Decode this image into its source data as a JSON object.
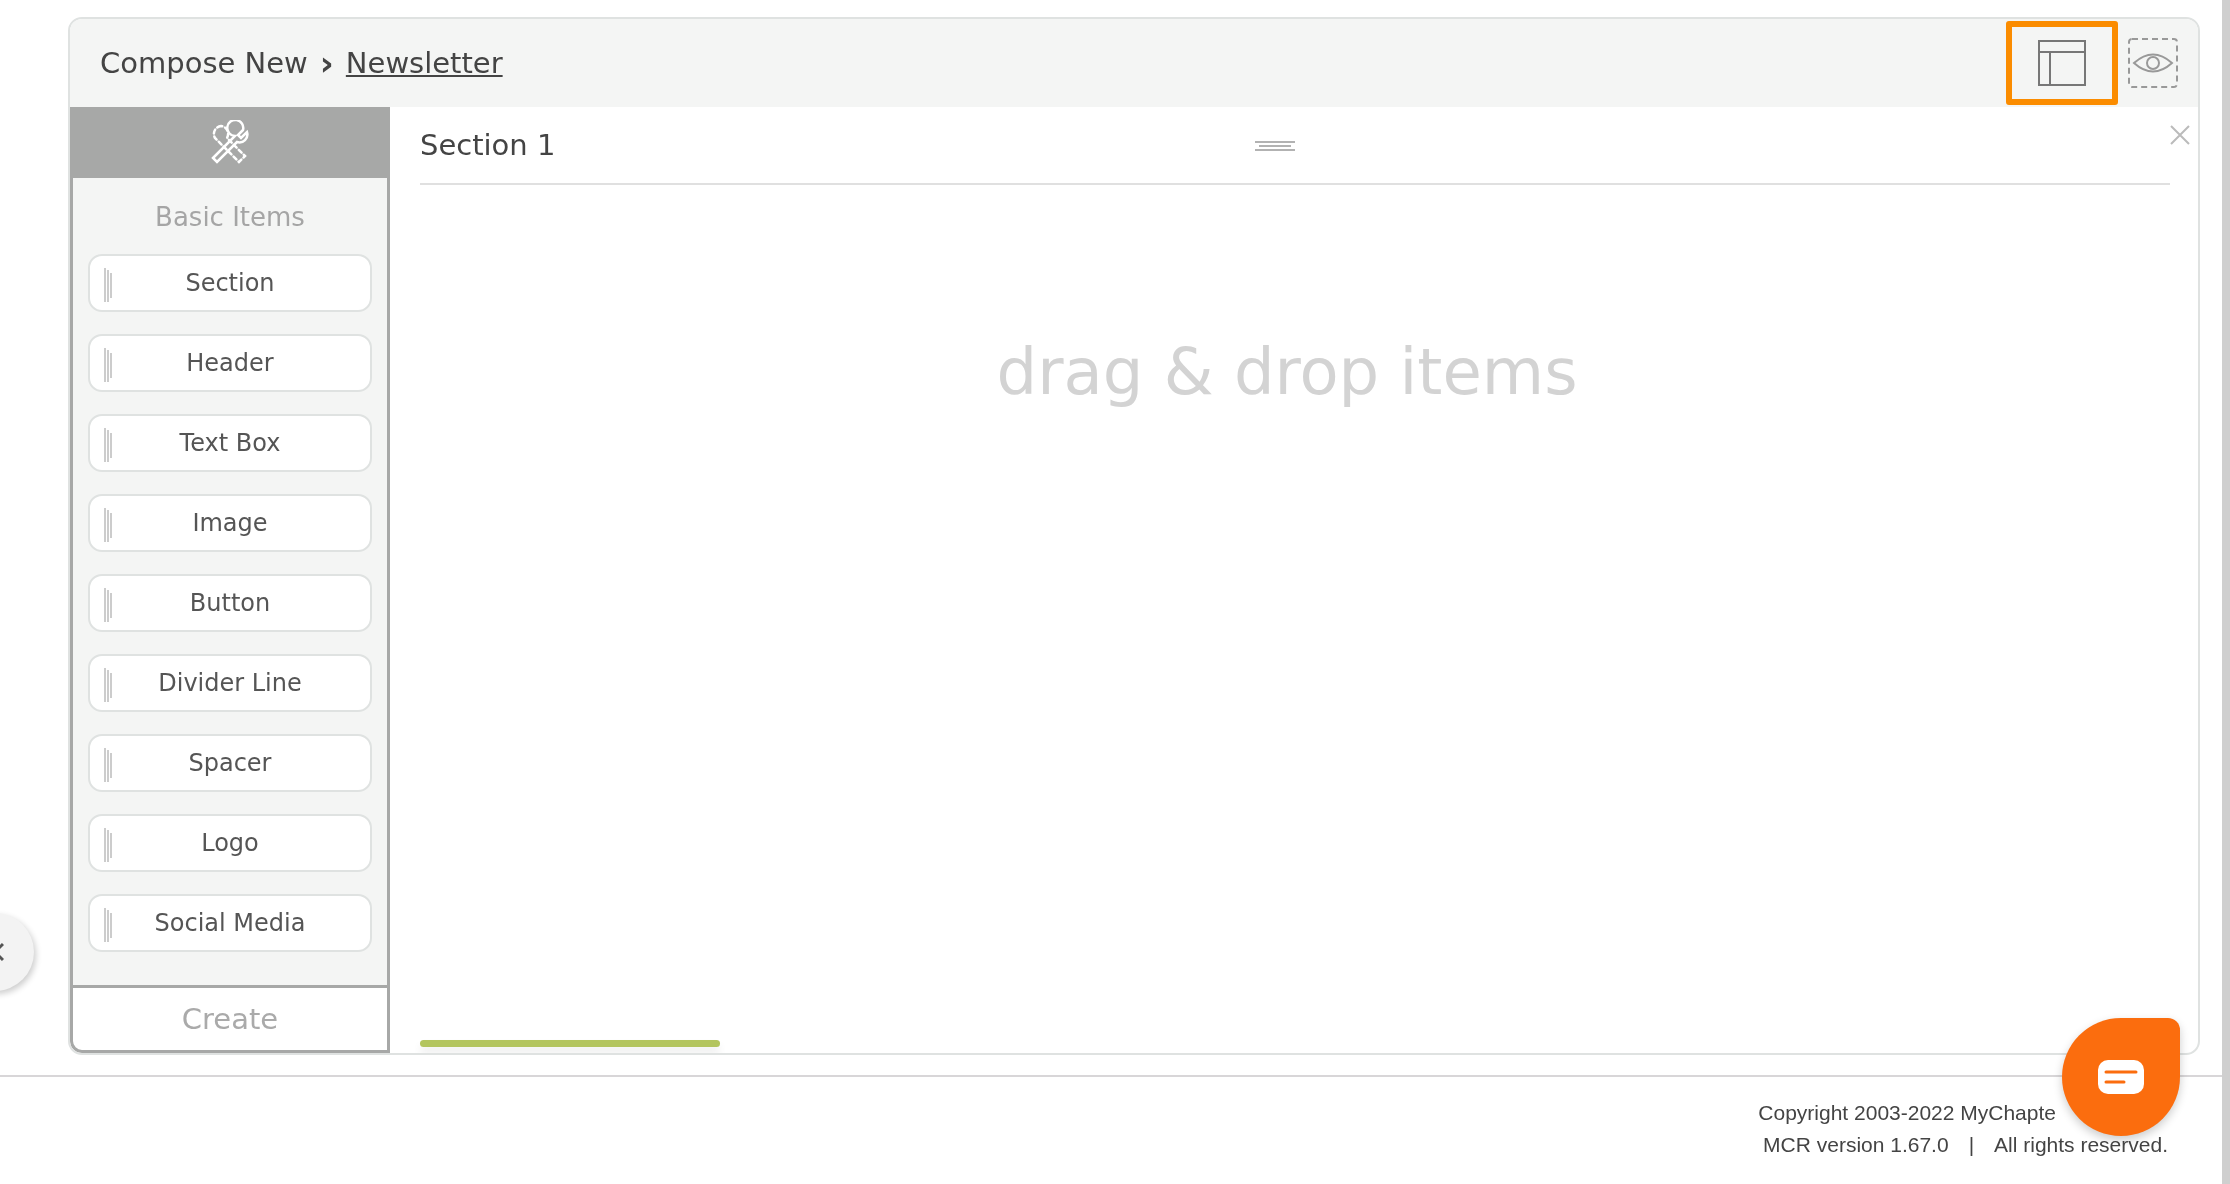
{
  "breadcrumb": {
    "parent": "Compose New",
    "separator": "›",
    "current": "Newsletter"
  },
  "toolbar": [
    {
      "kind": "layout",
      "selected": true
    },
    {
      "kind": "preview",
      "selected": false
    }
  ],
  "sidebar": {
    "heading": "Basic Items",
    "items": [
      "Section",
      "Header",
      "Text Box",
      "Image",
      "Button",
      "Divider Line",
      "Spacer",
      "Logo",
      "Social Media"
    ],
    "create_button": "Create"
  },
  "section": {
    "title": "Section 1",
    "placeholder": "drag & drop items"
  },
  "footer": {
    "copyright": "Copyright 2003-2022 MyChapte",
    "version": "MCR version 1.67.0",
    "separator": "|",
    "rights": "All rights reserved."
  }
}
